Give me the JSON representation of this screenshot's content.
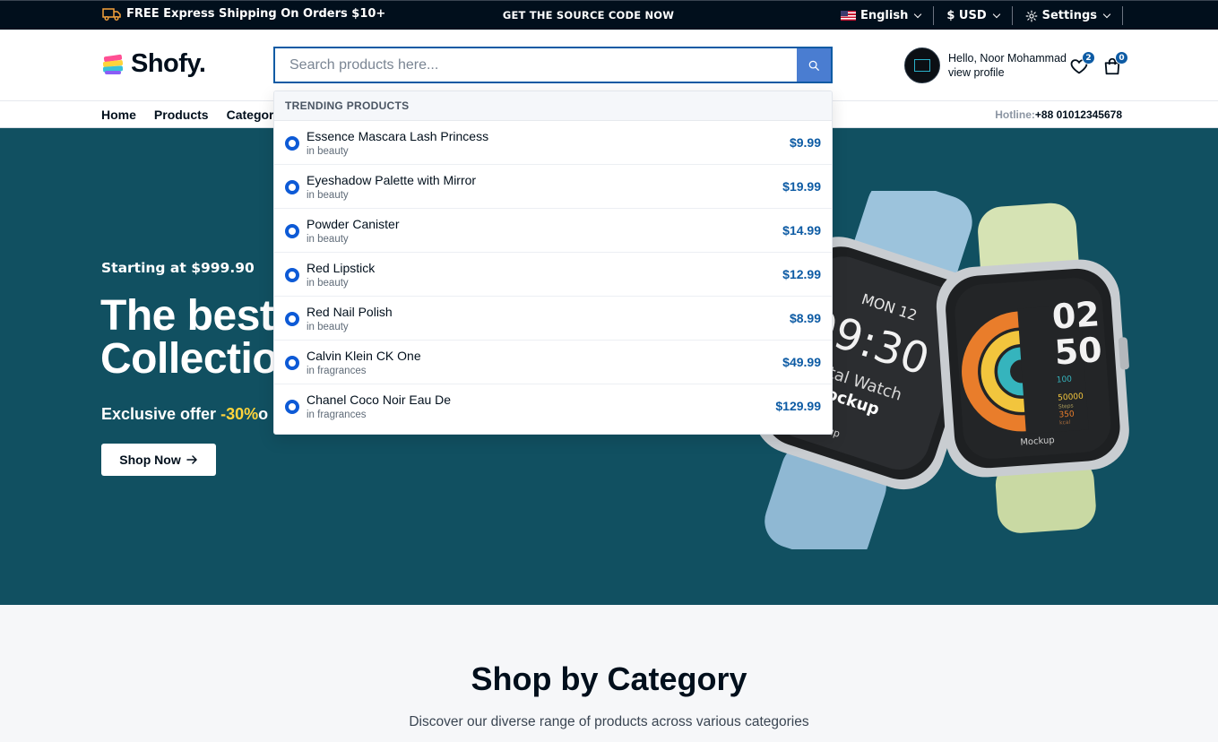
{
  "topbar": {
    "shipping_text": "FREE Express Shipping On Orders $10+",
    "source_code_text": "GET THE SOURCE CODE NOW",
    "language": "English",
    "currency": "$ USD",
    "settings": "Settings"
  },
  "header": {
    "logo_text": "Shofy.",
    "search_placeholder": "Search products here...",
    "user_greeting": "Hello, Noor Mohammad",
    "user_link": "view profile",
    "wishlist_count": "2",
    "cart_count": "0"
  },
  "nav": {
    "items": [
      "Home",
      "Products",
      "Categories"
    ],
    "hotline_label": "Hotline:",
    "hotline_number": "+88 01012345678"
  },
  "hero": {
    "starting": "Starting at $999.90",
    "title_line1": "The best",
    "title_line2": "Collectio",
    "offer_prefix": "Exclusive offer",
    "offer_percent": "-30%",
    "offer_suffix": "o",
    "button_label": "Shop Now"
  },
  "watch_face": {
    "left_date": "MON 12",
    "left_time": "09:30",
    "left_caption_1": "igital Watch",
    "left_caption_2": "Mockup",
    "left_brand": "Mockup",
    "right_hour": "02",
    "right_minute": "50",
    "right_stat_1": "100",
    "right_stat_2": "50000",
    "right_stat_2_unit": "Steps",
    "right_stat_3": "350",
    "right_stat_3_unit": "kcal",
    "right_brand": "Mockup"
  },
  "dropdown": {
    "heading": "TRENDING PRODUCTS",
    "items": [
      {
        "name": "Essence Mascara Lash Princess",
        "category": "in beauty",
        "price": "$9.99"
      },
      {
        "name": "Eyeshadow Palette with Mirror",
        "category": "in beauty",
        "price": "$19.99"
      },
      {
        "name": "Powder Canister",
        "category": "in beauty",
        "price": "$14.99"
      },
      {
        "name": "Red Lipstick",
        "category": "in beauty",
        "price": "$12.99"
      },
      {
        "name": "Red Nail Polish",
        "category": "in beauty",
        "price": "$8.99"
      },
      {
        "name": "Calvin Klein CK One",
        "category": "in fragrances",
        "price": "$49.99"
      },
      {
        "name": "Chanel Coco Noir Eau De",
        "category": "in fragrances",
        "price": "$129.99"
      }
    ]
  },
  "category_section": {
    "title": "Shop by Category",
    "subtitle": "Discover our diverse range of products across various categories"
  },
  "colors": {
    "topbar_bg": "#010f1c",
    "hero_bg": "#115061",
    "accent": "#0d5ba4",
    "offer_highlight": "#ffd43b"
  },
  "icons": [
    "truck-icon",
    "flag-us-icon",
    "chevron-down-icon",
    "gear-icon",
    "search-icon",
    "heart-icon",
    "bag-icon",
    "arrow-right-icon"
  ]
}
